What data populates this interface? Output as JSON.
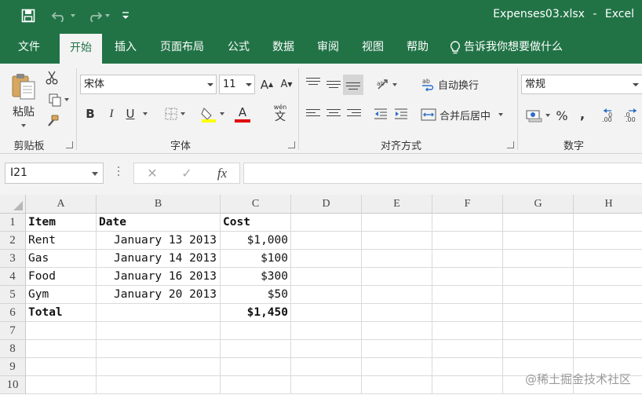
{
  "app": {
    "filename": "Expenses03.xlsx",
    "separator": "-",
    "app_name": "Excel"
  },
  "tabs": [
    {
      "label": "文件"
    },
    {
      "label": "开始"
    },
    {
      "label": "插入"
    },
    {
      "label": "页面布局"
    },
    {
      "label": "公式"
    },
    {
      "label": "数据"
    },
    {
      "label": "审阅"
    },
    {
      "label": "视图"
    },
    {
      "label": "帮助"
    }
  ],
  "tell_me": "告诉我你想要做什么",
  "ribbon": {
    "clipboard": {
      "label": "剪贴板",
      "paste": "粘贴"
    },
    "font": {
      "label": "字体",
      "font_name": "宋体",
      "font_size": "11",
      "bold": "B",
      "italic": "I",
      "underline": "U",
      "grow": "A",
      "shrink": "A",
      "font_color_glyph": "A",
      "phonetic": "文",
      "phonetic_top": "wén"
    },
    "alignment": {
      "label": "对齐方式",
      "wrap_text": "自动换行",
      "merge_center": "合并后居中"
    },
    "number": {
      "label": "数字",
      "format": "常规",
      "percent": "%",
      "comma": ","
    },
    "colors": {
      "highlight": "#ffff00",
      "font_color": "#e00000",
      "brand": "#217346"
    }
  },
  "formula_bar": {
    "name_box": "I21",
    "cancel": "✕",
    "enter": "✓",
    "fx": "fx",
    "formula": ""
  },
  "sheet": {
    "columns": [
      "A",
      "B",
      "C",
      "D",
      "E",
      "F",
      "G",
      "H"
    ],
    "rows": [
      "1",
      "2",
      "3",
      "4",
      "5",
      "6",
      "7",
      "8",
      "9",
      "10"
    ],
    "cells": [
      [
        "Item",
        "Date",
        "Cost"
      ],
      [
        "Rent",
        "January 13 2013",
        "$1,000"
      ],
      [
        "Gas",
        "January 14 2013",
        "$100"
      ],
      [
        "Food",
        "January 16 2013",
        "$300"
      ],
      [
        "Gym",
        "January 20 2013",
        "$50"
      ],
      [
        "Total",
        "",
        "$1,450"
      ]
    ]
  },
  "watermark": "@稀土掘金技术社区"
}
